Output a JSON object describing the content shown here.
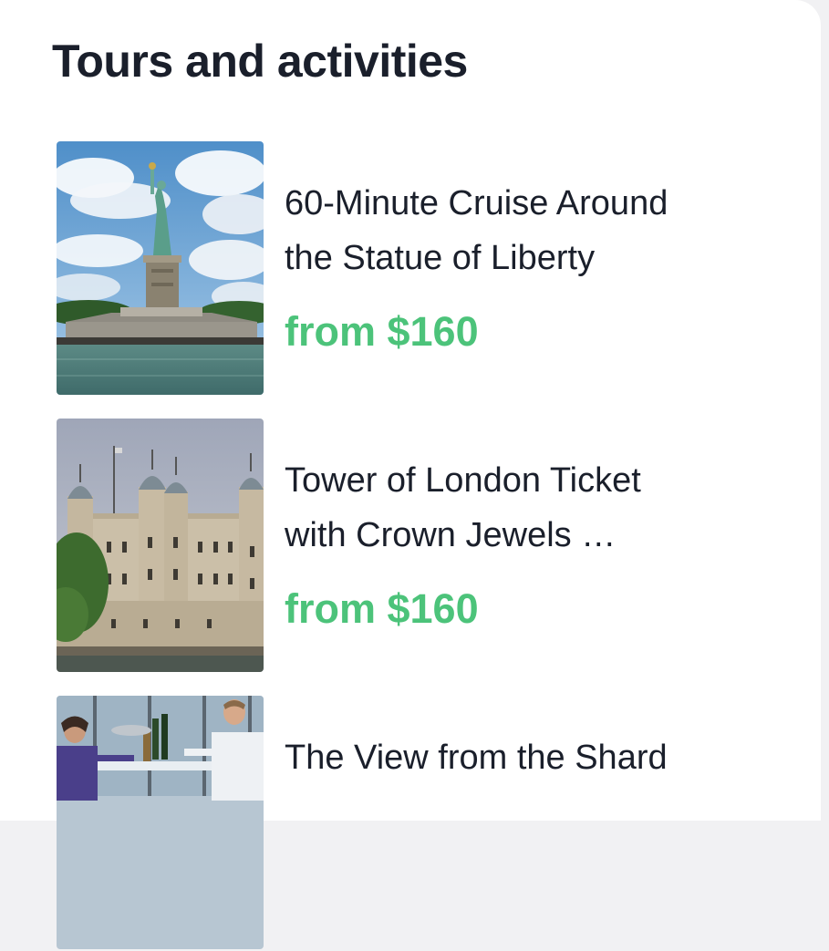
{
  "section": {
    "title": "Tours and activities"
  },
  "tours": [
    {
      "title_line1": "60-Minute Cruise Around",
      "title_line2": "the Statue of Liberty",
      "price": "from $160",
      "image": "statue-of-liberty-photo"
    },
    {
      "title_line1": "Tower of London Ticket",
      "title_line2": "with Crown Jewels …",
      "price": "from $160",
      "image": "tower-of-london-photo"
    },
    {
      "title_line1": "The View from the Shard",
      "title_line2": "",
      "price": "",
      "image": "shard-view-photo"
    }
  ],
  "colors": {
    "price": "#4cc37a",
    "heading": "#1a1f2b",
    "background": "#ffffff"
  }
}
